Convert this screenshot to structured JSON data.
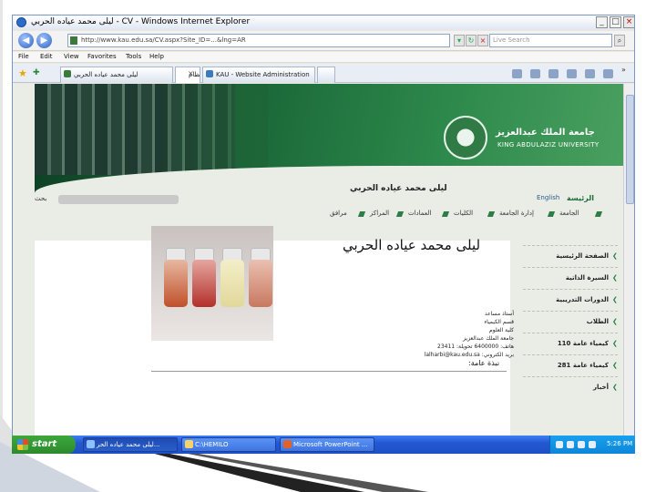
{
  "window": {
    "title": "ليلى محمد عياده الحربي  - CV - Windows Internet Explorer",
    "controls": [
      "_",
      "□",
      "×"
    ]
  },
  "address_bar": {
    "url": "http://www.kau.edu.sa/CV.aspx?Site_ID=...&lng=AR",
    "search_placeholder": "Live Search"
  },
  "menu": [
    "File",
    "Edit",
    "View",
    "Favorites",
    "Tools",
    "Help"
  ],
  "tabs": [
    {
      "label": "ليلى محمد عياده الحربي",
      "active": false
    },
    {
      "label": "نظام...",
      "active": true
    },
    {
      "label": "KAU - Website Administration",
      "active": false
    }
  ],
  "site": {
    "university_ar": "جامعة الملك عبدالعزيز",
    "university_en": "KING ABDULAZIZ UNIVERSITY",
    "banner_name": "ليلى محمد عياده الحربي",
    "search_label": "بحث",
    "lang_link": "English",
    "home_link": "الرئيسة",
    "nav": [
      "الجامعة",
      "إدارة الجامعة",
      "الكليات",
      "العمادات",
      "المراكز",
      "مرافق"
    ]
  },
  "profile": {
    "name": "ليلى محمد عياده الحربي",
    "info_lines": [
      "أستاذ مساعد",
      "قسم الكيمياء",
      "كلية العلوم",
      "جامعة الملك عبدالعزيز",
      "هاتف: 6400000 تحويلة: 23411",
      "بريد الكتروني: lalharbi@kau.edu.sa"
    ],
    "bio_label": "نبذة عامة:"
  },
  "sidebar": [
    "الصفحة الرئيسية",
    "السيرة الذاتية",
    "الدورات التدريبية",
    "الطلاب",
    "كيمياء عامة 110",
    "كيمياء عامة 281",
    "أخبار"
  ],
  "taskbar": {
    "start_label": "start",
    "items": [
      {
        "label": "ليلى محمد عياده الحر...",
        "active": true
      },
      {
        "label": "C:\\HEMILO",
        "active": false
      },
      {
        "label": "Microsoft PowerPoint ...",
        "active": false
      }
    ],
    "clock": "5:26 PM"
  },
  "colors": {
    "brand_green": "#1c6b3a",
    "taskbar_blue": "#2458d4",
    "start_green": "#3ca83c"
  }
}
